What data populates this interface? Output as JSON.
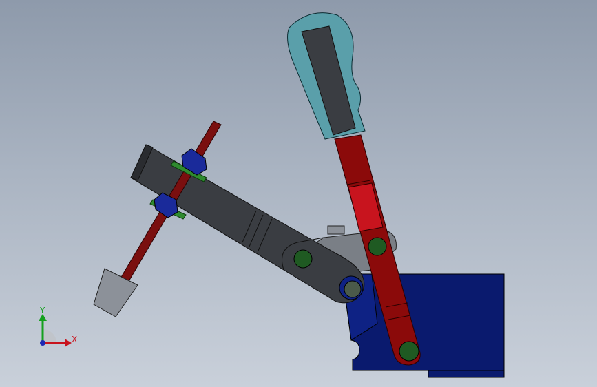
{
  "viewport": {
    "background_top": "#8e9aab",
    "background_bottom": "#c9d0da"
  },
  "model": {
    "parts": [
      {
        "name": "handle-grip",
        "color": "#5a9faa"
      },
      {
        "name": "handle-lever",
        "color": "#8b0a0a"
      },
      {
        "name": "clamp-arm",
        "color": "#3a3d42"
      },
      {
        "name": "spindle",
        "color": "#7a0f0f"
      },
      {
        "name": "spindle-nut",
        "color": "#1a2a9a"
      },
      {
        "name": "washer",
        "color": "#2f8a2f"
      },
      {
        "name": "pressure-pad",
        "color": "#8c9199"
      },
      {
        "name": "link-plate",
        "color": "#7a7f86"
      },
      {
        "name": "base",
        "color": "#0a1a6e"
      },
      {
        "name": "pivot-pin",
        "color": "#1f5a22"
      }
    ]
  },
  "triad": {
    "x_label": "X",
    "y_label": "Y",
    "x_color": "#c8141e",
    "y_color": "#14a01e",
    "z_color": "#1e28b4"
  }
}
